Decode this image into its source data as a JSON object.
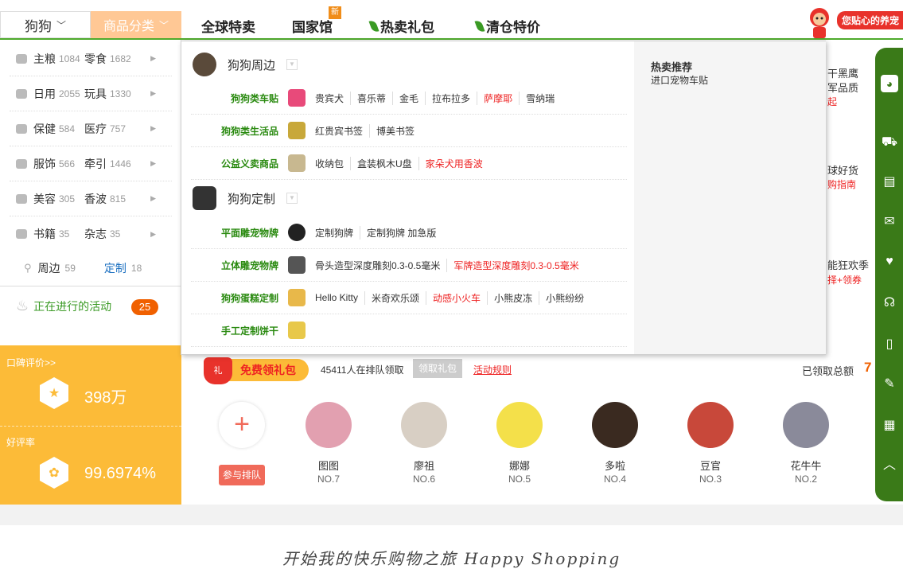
{
  "nav": {
    "pet": "狗狗",
    "category": "商品分类",
    "links": [
      "全球特卖",
      "国家馆",
      "热卖礼包",
      "清仓特价"
    ],
    "new_badge": "新",
    "mascot_text": "您贴心的养宠"
  },
  "left_menu": {
    "rows": [
      {
        "a": "主粮",
        "a_count": "1084",
        "b": "零食",
        "b_count": "1682"
      },
      {
        "a": "日用",
        "a_count": "2055",
        "b": "玩具",
        "b_count": "1330"
      },
      {
        "a": "保健",
        "a_count": "584",
        "b": "医疗",
        "b_count": "757"
      },
      {
        "a": "服饰",
        "a_count": "566",
        "b": "牵引",
        "b_count": "1446"
      },
      {
        "a": "美容",
        "a_count": "305",
        "b": "香波",
        "b_count": "815"
      },
      {
        "a": "书籍",
        "a_count": "35",
        "b": "杂志",
        "b_count": "35"
      }
    ],
    "surround": "周边",
    "surround_count": "59",
    "custom": "定制",
    "custom_count": "18"
  },
  "activity": {
    "label": "正在进行的活动",
    "count": "25"
  },
  "stats": {
    "rating_label": "口碑评价>>",
    "rating_value": "398万",
    "good_label": "好评率",
    "good_value": "99.6974%"
  },
  "dropdown": {
    "group1": {
      "title": "狗狗周边",
      "subs": [
        {
          "name": "狗狗类车贴",
          "items": [
            {
              "t": "贵宾犬"
            },
            {
              "t": "喜乐蒂"
            },
            {
              "t": "金毛"
            },
            {
              "t": "拉布拉多"
            },
            {
              "t": "萨摩耶",
              "red": true
            },
            {
              "t": "雪纳瑞"
            }
          ]
        },
        {
          "name": "狗狗类生活品",
          "items": [
            {
              "t": "红贵宾书签"
            },
            {
              "t": "博美书签"
            }
          ]
        },
        {
          "name": "公益义卖商品",
          "items": [
            {
              "t": "收纳包"
            },
            {
              "t": "盒装枫木U盘"
            },
            {
              "t": "家朵犬用香波",
              "red": true
            }
          ]
        }
      ]
    },
    "group2": {
      "title": "狗狗定制",
      "subs": [
        {
          "name": "平面雕宠物牌",
          "items": [
            {
              "t": "定制狗牌"
            },
            {
              "t": "定制狗牌 加急版"
            }
          ]
        },
        {
          "name": "立体雕宠物牌",
          "items": [
            {
              "t": "骨头造型深度雕刻0.3-0.5毫米"
            },
            {
              "t": "军牌造型深度雕刻0.3-0.5毫米",
              "red": true
            }
          ]
        },
        {
          "name": "狗狗蛋糕定制",
          "items": [
            {
              "t": "Hello Kitty"
            },
            {
              "t": "米奇欢乐颂"
            },
            {
              "t": "动感小火车",
              "red": true
            },
            {
              "t": "小熊皮冻"
            },
            {
              "t": "小熊纷纷"
            }
          ]
        },
        {
          "name": "手工定制饼干",
          "items": []
        }
      ]
    },
    "hot_title": "热卖推荐",
    "hot_sub": "进口宠物车贴"
  },
  "behind": {
    "f1": "干黑鹰",
    "f2": "军品质",
    "f3": "起",
    "f4": "球好货",
    "f5": "购指南",
    "f6": "能狂欢季",
    "f7": "择+领券"
  },
  "gift": {
    "button": "免费领礼包",
    "bag": "礼",
    "queue_text": "45411人在排队领取",
    "receive": "领取礼包",
    "rules": "活动规则",
    "total_label": "已领取总额",
    "total_value": "7",
    "join": "参与排队",
    "people": [
      {
        "name": "图图",
        "no": "NO.7",
        "color": "#e2a0b0"
      },
      {
        "name": "廖祖",
        "no": "NO.6",
        "color": "#d8cfc4"
      },
      {
        "name": "娜娜",
        "no": "NO.5",
        "color": "#f4e04a"
      },
      {
        "name": "多啦",
        "no": "NO.4",
        "color": "#3a2a20"
      },
      {
        "name": "豆官",
        "no": "NO.3",
        "color": "#c8483a"
      },
      {
        "name": "花牛牛",
        "no": "NO.2",
        "color": "#8a8a9a"
      }
    ]
  },
  "footer": {
    "tagline": "开始我的快乐购物之旅 Happy Shopping"
  },
  "colors": {
    "green": "#4eaa2b",
    "orange": "#fcbb38",
    "red": "#e22222",
    "sidebar": "#3a7a18"
  }
}
